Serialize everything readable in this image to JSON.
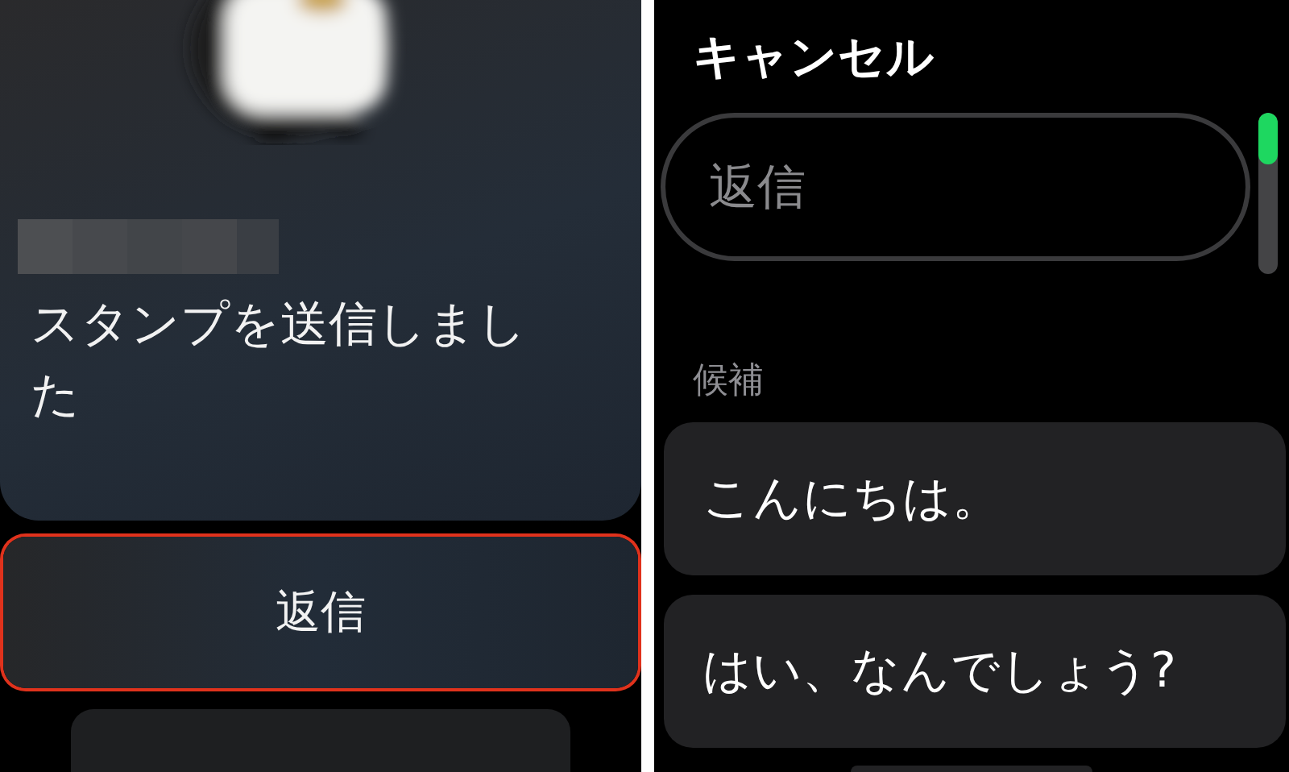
{
  "message_screen": {
    "message": "スタンプを送信しました",
    "reply_button": {
      "label": "返信",
      "highlighted": true
    }
  },
  "reply_screen": {
    "cancel": "キャンセル",
    "reply_field": {
      "placeholder": "返信"
    },
    "suggestions_heading": "候補",
    "suggestions": [
      {
        "label": "こんにちは。"
      },
      {
        "label": "はい、なんでしょう?"
      }
    ]
  }
}
